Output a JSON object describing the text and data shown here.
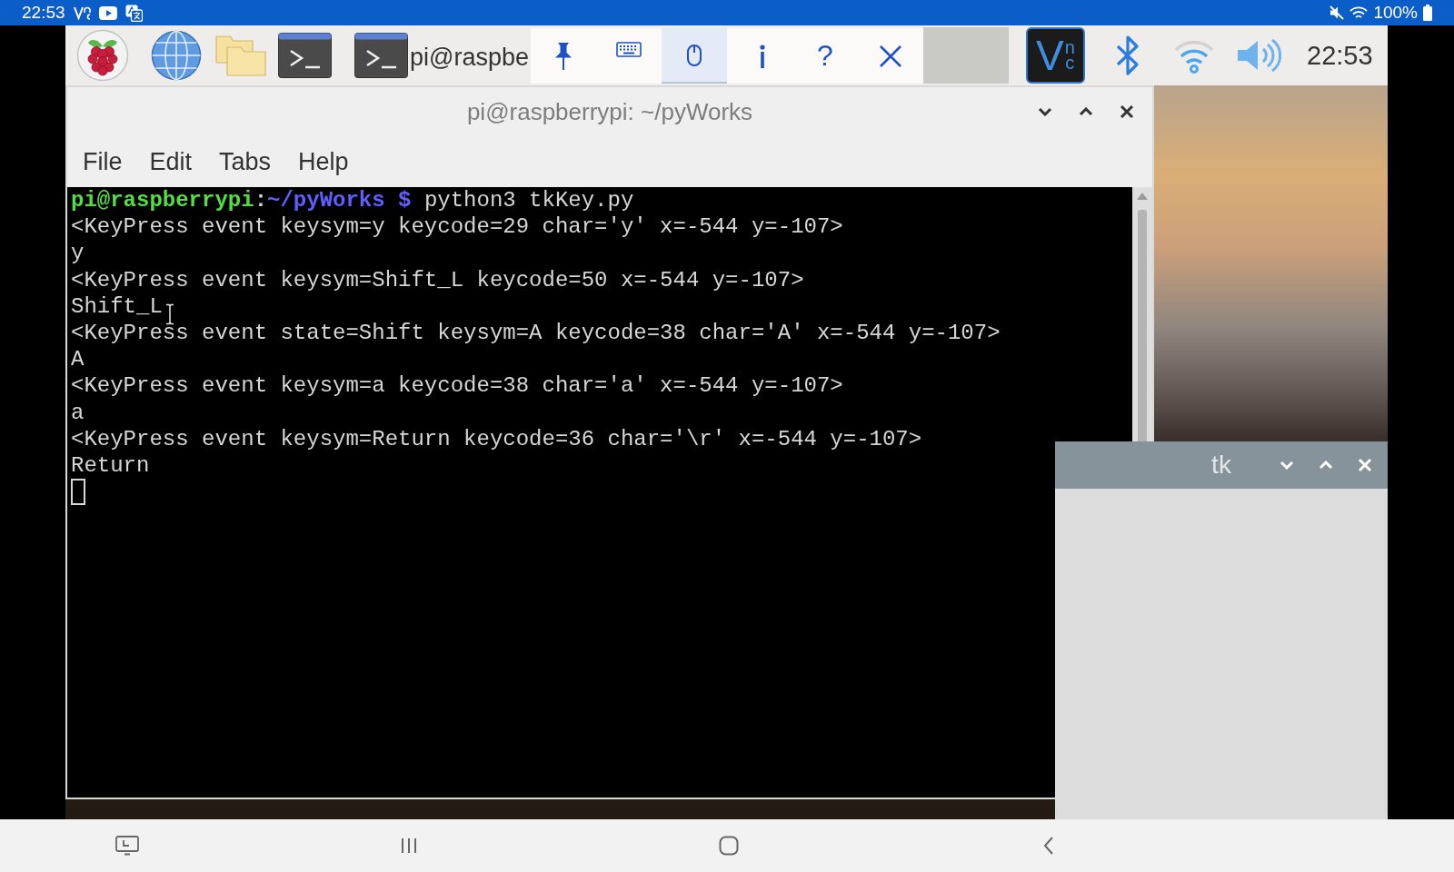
{
  "status_bar": {
    "time": "22:53",
    "battery": "100%"
  },
  "taskbar": {
    "tasks": [
      {
        "label": "pi@raspbe",
        "selected": false
      },
      {
        "selected": true
      }
    ],
    "logo": {
      "letter": "V",
      "stack": [
        "n",
        "c"
      ]
    },
    "clock": "22:53"
  },
  "vnc_toolbar": {
    "buttons": [
      {
        "kind": "pin",
        "on": false
      },
      {
        "kind": "keyboard",
        "on": false
      },
      {
        "kind": "mouse",
        "on": true
      },
      {
        "kind": "info",
        "on": false
      },
      {
        "kind": "help",
        "on": false,
        "label": "?"
      },
      {
        "kind": "close",
        "on": false
      }
    ]
  },
  "terminal_window": {
    "title": "pi@raspberrypi: ~/pyWorks",
    "menu": [
      "File",
      "Edit",
      "Tabs",
      "Help"
    ],
    "prompt": {
      "user": "pi@raspberrypi",
      "separator": ":",
      "path": "~/pyWorks $",
      "command": "python3 tkKey.py"
    },
    "lines": [
      "<KeyPress event keysym=y keycode=29 char='y' x=-544 y=-107>",
      "y",
      "<KeyPress event keysym=Shift_L keycode=50 x=-544 y=-107>",
      "Shift_L",
      "<KeyPress event state=Shift keysym=A keycode=38 char='A' x=-544 y=-107>",
      "A",
      "<KeyPress event keysym=a keycode=38 char='a' x=-544 y=-107>",
      "a",
      "<KeyPress event keysym=Return keycode=36 char='\\r' x=-544 y=-107>",
      "Return"
    ]
  },
  "tk_window": {
    "title": "tk"
  }
}
